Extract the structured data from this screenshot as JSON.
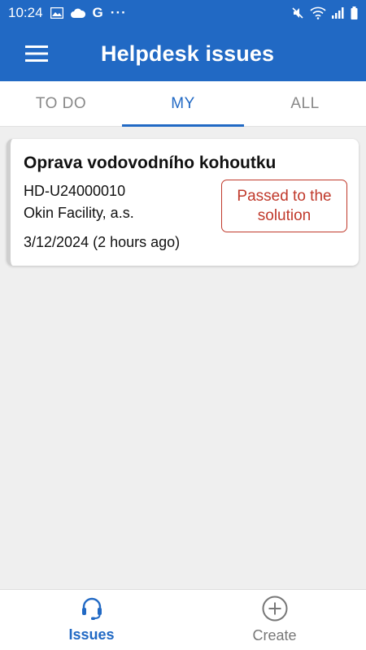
{
  "status_bar": {
    "time": "10:24",
    "g_letter": "G",
    "more": "···",
    "icons_left": [
      "image-icon",
      "cloud-icon",
      "google-icon",
      "more-dots-icon"
    ],
    "icons_right": [
      "mute-icon",
      "wifi-icon",
      "signal-icon",
      "battery-icon"
    ]
  },
  "app_bar": {
    "title": "Helpdesk issues",
    "menu_icon": "hamburger-menu-icon"
  },
  "tabs": [
    {
      "label": "TO DO",
      "active": false
    },
    {
      "label": "MY",
      "active": true
    },
    {
      "label": "ALL",
      "active": false
    }
  ],
  "issues": [
    {
      "title": "Oprava vodovodního kohoutku",
      "id": "HD-U24000010",
      "company": "Okin Facility, a.s.",
      "date": "3/12/2024 (2 hours ago)",
      "status": "Passed to the solution"
    }
  ],
  "bottom_nav": [
    {
      "label": "Issues",
      "icon": "headset-icon",
      "active": true
    },
    {
      "label": "Create",
      "icon": "plus-circle-icon",
      "active": false
    }
  ],
  "colors": {
    "primary": "#2169c4",
    "status_border": "#c0392b",
    "background": "#efefef"
  }
}
